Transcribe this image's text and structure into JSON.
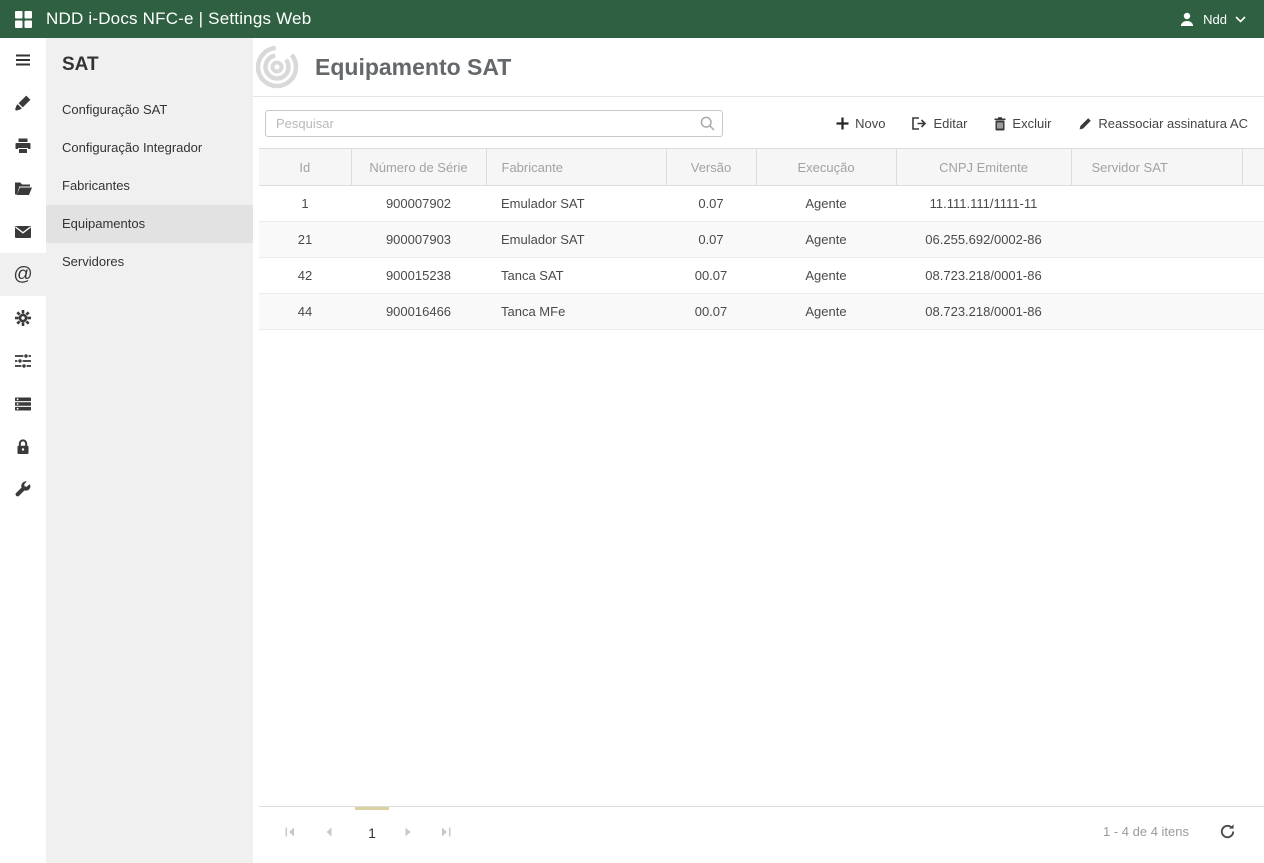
{
  "topbar": {
    "title": "NDD i-Docs NFC-e | Settings Web",
    "user": "Ndd"
  },
  "rail": {
    "icons": [
      "menu-icon",
      "brush-icon",
      "printer-icon",
      "folder-icon",
      "envelope-icon",
      "at-icon",
      "gear-icon",
      "sliders-icon",
      "queue-icon",
      "lock-icon",
      "wrench-icon"
    ],
    "at_glyph": "@"
  },
  "sidebar": {
    "title": "SAT",
    "items": [
      {
        "label": "Configuração SAT"
      },
      {
        "label": "Configuração Integrador"
      },
      {
        "label": "Fabricantes"
      },
      {
        "label": "Equipamentos",
        "active": true
      },
      {
        "label": "Servidores"
      }
    ]
  },
  "page": {
    "title": "Equipamento SAT"
  },
  "search": {
    "placeholder": "Pesquisar"
  },
  "toolbar": {
    "novo": "Novo",
    "editar": "Editar",
    "excluir": "Excluir",
    "reassociar": "Reassociar assinatura AC"
  },
  "table": {
    "columns": [
      "Id",
      "Número de Série",
      "Fabricante",
      "Versão",
      "Execução",
      "CNPJ Emitente",
      "Servidor SAT"
    ],
    "rows": [
      [
        "1",
        "900007902",
        "Emulador SAT",
        "0.07",
        "Agente",
        "11.111.111/1111-11",
        ""
      ],
      [
        "21",
        "900007903",
        "Emulador SAT",
        "0.07",
        "Agente",
        "06.255.692/0002-86",
        ""
      ],
      [
        "42",
        "900015238",
        "Tanca SAT",
        "00.07",
        "Agente",
        "08.723.218/0001-86",
        ""
      ],
      [
        "44",
        "900016466",
        "Tanca MFe",
        "00.07",
        "Agente",
        "08.723.218/0001-86",
        ""
      ]
    ]
  },
  "pager": {
    "page": "1",
    "info": "1 - 4 de 4 itens"
  },
  "colors": {
    "topbar_green": "#2e6041",
    "sidebar_gray": "#f0f0f0",
    "active_item_gray": "#e2e2e2",
    "pager_accent": "#d9d19f"
  }
}
